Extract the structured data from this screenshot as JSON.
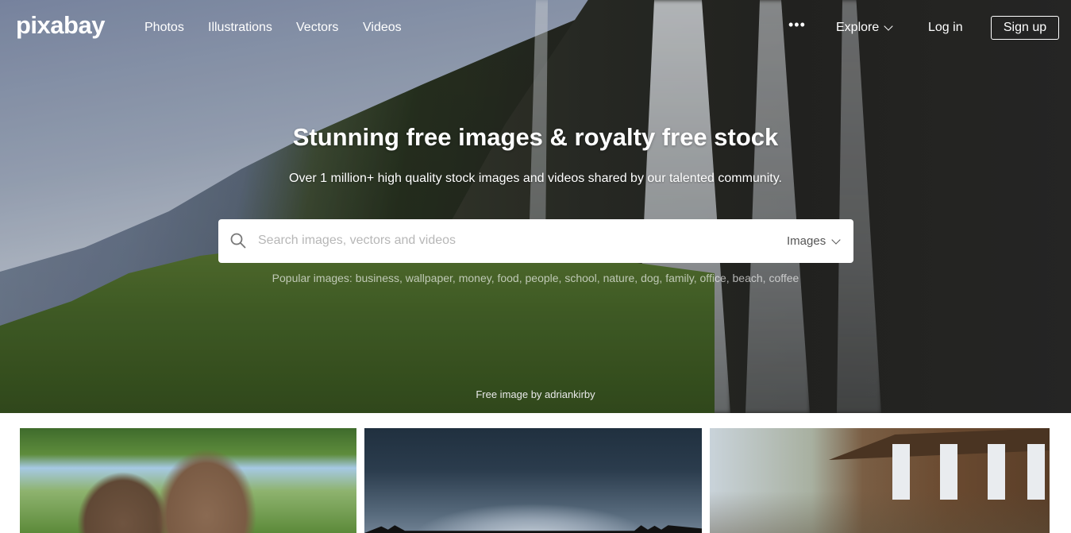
{
  "nav": {
    "logo": "pixabay",
    "links": [
      "Photos",
      "Illustrations",
      "Vectors",
      "Videos"
    ],
    "more": "•••",
    "explore": "Explore",
    "login": "Log in",
    "signup": "Sign up"
  },
  "hero": {
    "title": "Stunning free images & royalty free stock",
    "subtitle": "Over 1 million+ high quality stock images and videos shared by our talented community.",
    "search": {
      "placeholder": "Search images, vectors and videos",
      "type": "Images"
    },
    "popular_label": "Popular images:",
    "popular_tags": [
      "business",
      "wallpaper",
      "money",
      "food",
      "people",
      "school",
      "nature",
      "dog",
      "family",
      "office",
      "beach",
      "coffee"
    ],
    "credit": "Free image by adriankirby"
  },
  "icons": {
    "search": "search-icon",
    "chevron": "chevron-down-icon",
    "more": "more-horizontal-icon"
  },
  "colors": {
    "text_on_hero": "#ffffff",
    "search_bg": "#ffffff",
    "placeholder": "#b7b7b7"
  }
}
